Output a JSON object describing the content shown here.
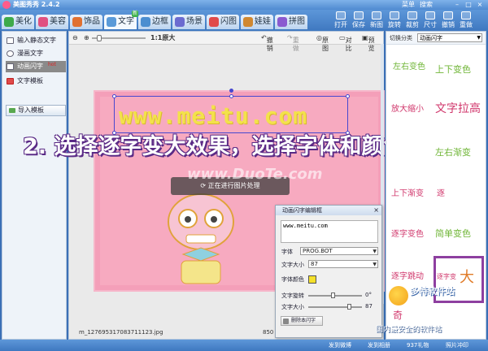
{
  "window": {
    "title": "美图秀秀 2.4.2",
    "menu": [
      "菜单",
      "搜索"
    ]
  },
  "tabs": [
    {
      "label": "美化",
      "color": "#3eaa4a"
    },
    {
      "label": "美容",
      "color": "#e05080"
    },
    {
      "label": "饰品",
      "color": "#e07030"
    },
    {
      "label": "文字",
      "color": "#5a9ad8",
      "badge": "新"
    },
    {
      "label": "边框",
      "color": "#4b8ed0"
    },
    {
      "label": "场景",
      "color": "#6b6bd0"
    },
    {
      "label": "闪图",
      "color": "#e04a4a"
    },
    {
      "label": "娃娃",
      "color": "#d08830"
    },
    {
      "label": "拼图",
      "color": "#8a5ad0"
    }
  ],
  "toolbar": [
    "打开",
    "保存",
    "新图",
    "旋转",
    "裁剪",
    "尺寸",
    "撤销",
    "重做"
  ],
  "left_panel": {
    "items": [
      "输入静态文字",
      "漫画文字",
      "动画闪字",
      "文字模板"
    ],
    "selected": "动画闪字",
    "hot_badge": "hot",
    "import_button": "导入模板"
  },
  "canvas_toolbar": {
    "zoom_label": "1:1原大",
    "undo": "撤销",
    "redo": "重做",
    "original": "原图",
    "compare": "对比",
    "preview": "预览"
  },
  "canvas": {
    "text_effect": "www.meitu.com",
    "processing": "正在进行图片处理",
    "filename": "m_127695317083711123.jpg",
    "size_label": "850"
  },
  "caption": "2. 选择逐字变大效果，选择字体和颜色",
  "watermark": "www.DuoTe.com",
  "dialog": {
    "title": "动画闪字编辑框",
    "close": "×",
    "text_value": "www.meitu.com",
    "font_label": "字体",
    "font_value": "PROG.BOT",
    "size_label": "文字大小",
    "size_value": "87",
    "color_label": "字体颜色",
    "text_color": "#f5e12a",
    "rotate_label": "文字旋转",
    "rotate_value": "0°",
    "scale_label": "文字大小",
    "scale_value": "87",
    "delete_button": "删除本闪字"
  },
  "right_panel": {
    "category_label": "切换分类",
    "category_value": "动画闪字",
    "effects": [
      "左右变色",
      "上下变色",
      "放大缩小",
      "文字拉高",
      "左右渐变",
      "上下渐变",
      "逐",
      "逐字变色",
      "简单变色",
      "逐字跳动",
      "逐字变",
      "大",
      "奇"
    ]
  },
  "statusbar": {
    "items": [
      "发到微博",
      "发到相册",
      "937礼物",
      "照片冲印"
    ]
  },
  "site": {
    "name": "多特软件站",
    "sub": "国内最安全的软件站"
  }
}
